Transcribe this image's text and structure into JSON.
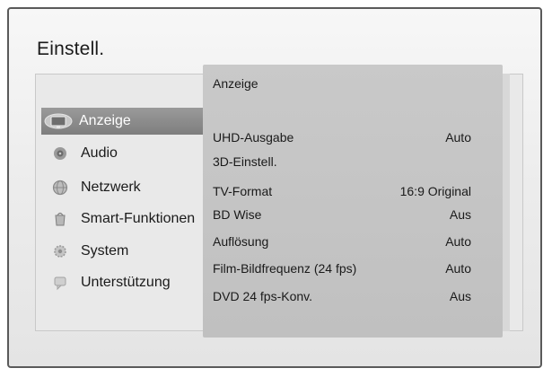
{
  "window": {
    "title": "Einstell."
  },
  "sidebar": {
    "items": [
      {
        "label": "Anzeige",
        "icon": "display-icon",
        "selected": true
      },
      {
        "label": "Audio",
        "icon": "speaker-icon",
        "selected": false
      },
      {
        "label": "Netzwerk",
        "icon": "globe-icon",
        "selected": false
      },
      {
        "label": "Smart-Funktionen",
        "icon": "smart-hub-icon",
        "selected": false
      },
      {
        "label": "System",
        "icon": "gear-icon",
        "selected": false
      },
      {
        "label": "Unterstützung",
        "icon": "support-icon",
        "selected": false
      }
    ]
  },
  "content": {
    "title": "Anzeige",
    "rows": [
      {
        "label": "UHD-Ausgabe",
        "value": "Auto"
      },
      {
        "label": "3D-Einstell.",
        "value": ""
      },
      {
        "label": "TV-Format",
        "value": "16:9 Original"
      },
      {
        "label": "BD Wise",
        "value": "Aus"
      },
      {
        "label": "Auflösung",
        "value": "Auto"
      },
      {
        "label": "Film-Bildfrequenz (24 fps)",
        "value": "Auto"
      },
      {
        "label": "DVD 24 fps-Konv.",
        "value": "Aus"
      }
    ]
  },
  "colors": {
    "selected_bg": "#8c8c8c",
    "content_bg": "#c6c6c6",
    "screen_bg": "#ececec"
  }
}
